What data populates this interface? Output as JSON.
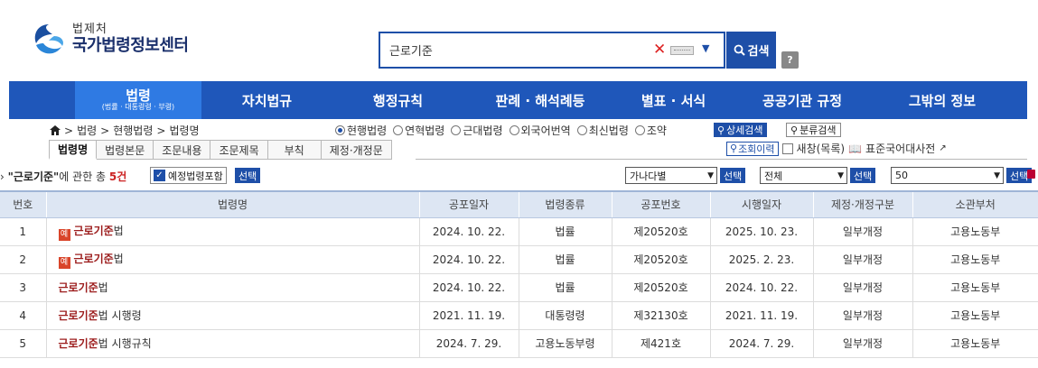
{
  "header": {
    "logo_sub": "법제처",
    "logo_main": "국가법령정보센터",
    "search_value": "근로기준",
    "search_button": "검색",
    "help_label": "?"
  },
  "nav": [
    {
      "label": "법령",
      "sub": "(법률 · 대통령령 · 부령)",
      "active": true
    },
    {
      "label": "자치법규"
    },
    {
      "label": "행정규칙"
    },
    {
      "label": "판례 · 해석례등"
    },
    {
      "label": "별표 · 서식"
    },
    {
      "label": "공공기관 규정"
    },
    {
      "label": "그밖의 정보"
    }
  ],
  "breadcrumb": [
    "법령",
    "현행법령",
    "법령명"
  ],
  "radios": [
    {
      "label": "현행법령",
      "checked": true
    },
    {
      "label": "연혁법령"
    },
    {
      "label": "근대법령"
    },
    {
      "label": "외국어번역"
    },
    {
      "label": "최신법령"
    },
    {
      "label": "조약"
    }
  ],
  "buttons": {
    "advanced": "상세검색",
    "classified": "분류검색",
    "history": "조회이력",
    "new_list": "새창(목록)",
    "dictionary": "표준국어대사전",
    "include_planned": "예정법령포함",
    "select": "선택"
  },
  "tabs": [
    "법령명",
    "법령본문",
    "조문내용",
    "조문제목",
    "부칙",
    "제정·개정문"
  ],
  "results": {
    "keyword": "\"근로기준\"",
    "middle": "에 관한 총",
    "count": "5건"
  },
  "dropdowns": {
    "sort": "가나다별",
    "scope": "전체",
    "page_size": "50"
  },
  "table": {
    "headers": [
      "번호",
      "법령명",
      "공포일자",
      "법령종류",
      "공포번호",
      "시행일자",
      "제정·개정구분",
      "소관부처"
    ],
    "rows": [
      {
        "no": "1",
        "badge": "예",
        "kw": "근로기준",
        "rest": "법",
        "date": "2024. 10. 22.",
        "type": "법률",
        "num": "제20520호",
        "eff": "2025. 10. 23.",
        "rev": "일부개정",
        "dept": "고용노동부"
      },
      {
        "no": "2",
        "badge": "예",
        "kw": "근로기준",
        "rest": "법",
        "date": "2024. 10. 22.",
        "type": "법률",
        "num": "제20520호",
        "eff": "2025. 2. 23.",
        "rev": "일부개정",
        "dept": "고용노동부"
      },
      {
        "no": "3",
        "badge": "",
        "kw": "근로기준",
        "rest": "법",
        "date": "2024. 10. 22.",
        "type": "법률",
        "num": "제20520호",
        "eff": "2024. 10. 22.",
        "rev": "일부개정",
        "dept": "고용노동부"
      },
      {
        "no": "4",
        "badge": "",
        "kw": "근로기준",
        "rest": "법 시행령",
        "date": "2021. 11. 19.",
        "type": "대통령령",
        "num": "제32130호",
        "eff": "2021. 11. 19.",
        "rev": "일부개정",
        "dept": "고용노동부"
      },
      {
        "no": "5",
        "badge": "",
        "kw": "근로기준",
        "rest": "법 시행규칙",
        "date": "2024. 7. 29.",
        "type": "고용노동부령",
        "num": "제421호",
        "eff": "2024. 7. 29.",
        "rev": "일부개정",
        "dept": "고용노동부"
      }
    ]
  },
  "colors": {
    "brand_blue": "#1f57ba",
    "active_blue": "#2f7ae3",
    "keyword_red": "#9c1c1c"
  }
}
